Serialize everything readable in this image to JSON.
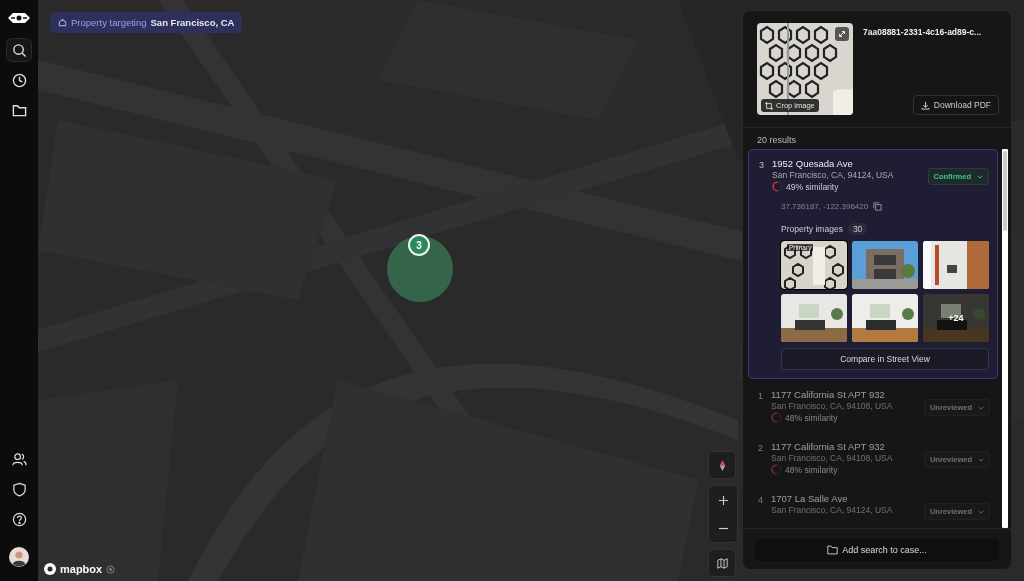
{
  "sidebar": {
    "items": [
      {
        "selected": true
      },
      {
        "selected": false
      },
      {
        "selected": false
      }
    ]
  },
  "targeting": {
    "label": "Property targeting",
    "location": "San Francisco, CA"
  },
  "map": {
    "marker": {
      "label": "3"
    },
    "attribution": "mapbox"
  },
  "panel": {
    "image": {
      "crop_label": "Crop image"
    },
    "id": "7aa08881-2331-4c16-ad89-c...",
    "download_label": "Download PDF",
    "results_count": "20 results",
    "results": [
      {
        "rank": "3",
        "address": "1952 Quesada Ave",
        "city": "San Francisco, CA, 94124, USA",
        "similarity": "49% similarity",
        "status": "Confirmed",
        "confirmed": true,
        "selected": true,
        "coords": "37.736187, -122.396420",
        "images_label": "Property images",
        "images_count": "30",
        "primary_label": "Primary",
        "more_label": "+24",
        "compare_label": "Compare in Street View"
      },
      {
        "rank": "1",
        "address": "1177 California St APT 932",
        "city": "San Francisco, CA, 94108, USA",
        "similarity": "48% similarity",
        "status": "Unreviewed",
        "confirmed": false,
        "selected": false
      },
      {
        "rank": "2",
        "address": "1177 California St APT 932",
        "city": "San Francisco, CA, 94108, USA",
        "similarity": "48% similarity",
        "status": "Unreviewed",
        "confirmed": false,
        "selected": false
      },
      {
        "rank": "4",
        "address": "1707 La Salle Ave",
        "city": "San Francisco, CA, 94124, USA",
        "status": "Unreviewed",
        "confirmed": false,
        "selected": false
      }
    ],
    "footer_label": "Add search to case..."
  }
}
